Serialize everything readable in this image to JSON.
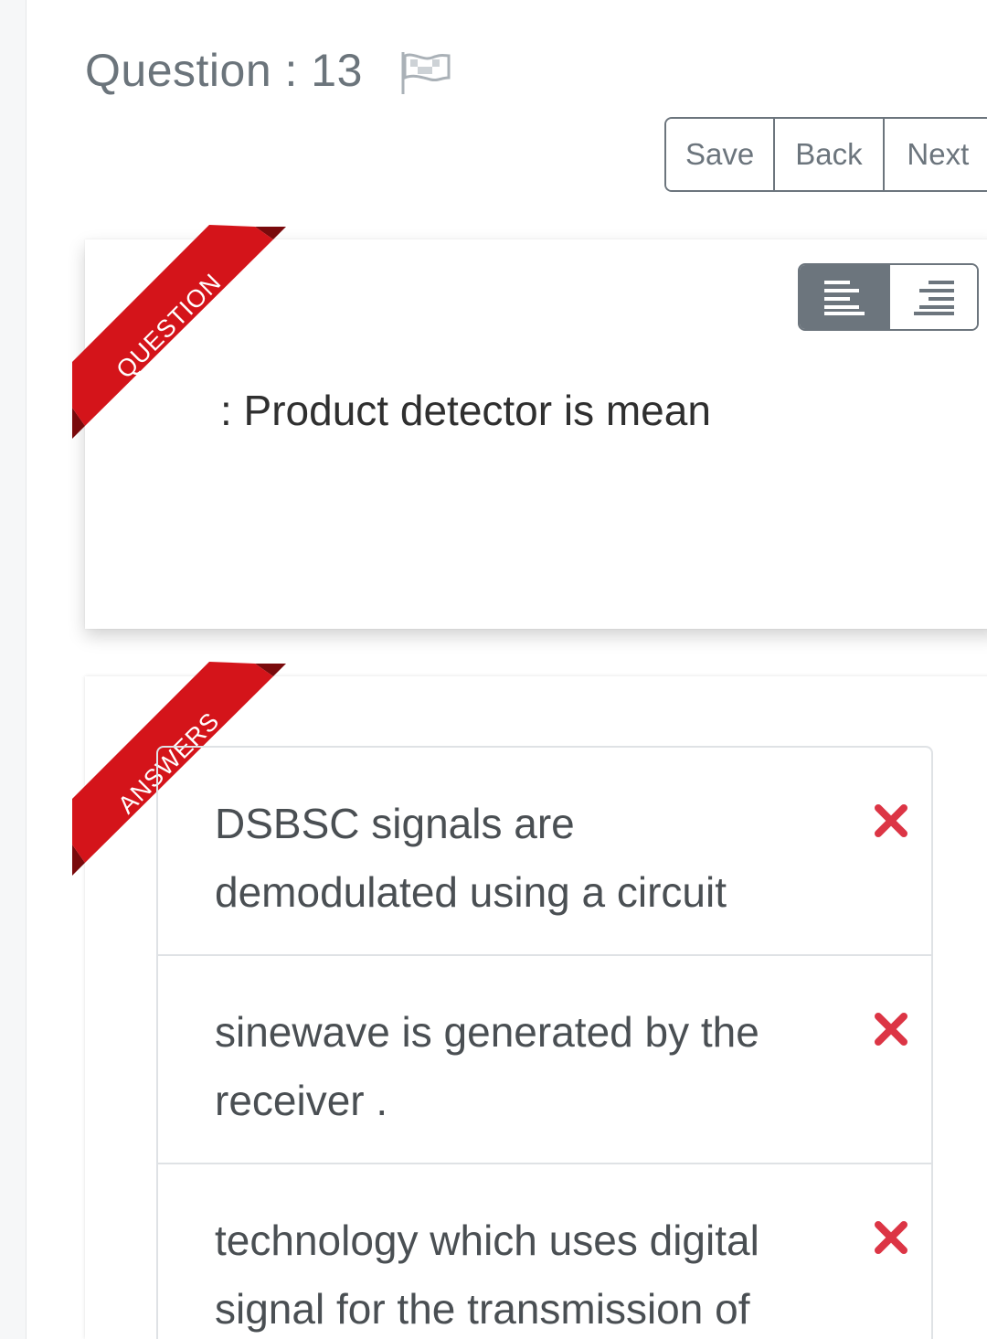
{
  "question": {
    "label": "Question : 13",
    "text": ": Product detector is mean",
    "ribbon": "QUESTION"
  },
  "actions": {
    "save": "Save",
    "back": "Back",
    "next": "Next"
  },
  "align_controls": {
    "left_icon": "align-left-icon",
    "right_icon": "align-right-icon",
    "active": "left"
  },
  "answers": {
    "ribbon": "ANSWERS",
    "items": [
      {
        "text": "DSBSC signals are demodulated using a circuit",
        "status_icon": "x-icon"
      },
      {
        "text": "sinewave is generated by the receiver .",
        "status_icon": "x-icon"
      },
      {
        "text": "technology which uses digital signal for the transmission of",
        "status_icon": "x-icon"
      }
    ]
  },
  "colors": {
    "ribbon": "#d4141a",
    "incorrect": "#dc3545",
    "button_border": "#6c757d"
  }
}
